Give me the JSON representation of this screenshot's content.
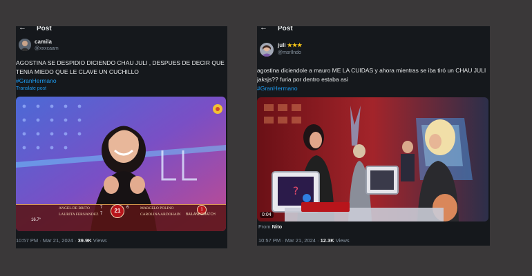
{
  "post1": {
    "header": {
      "title": "Post",
      "back_icon": "arrow-left-icon"
    },
    "author": {
      "name": "camila",
      "handle": "@xxxcaam"
    },
    "text": "AGOSTINA SE DESPIDIO DICIENDO CHAU JULI , DESPUES DE DECIR QUE TENIA MIEDO QUE LE CLAVE UN CUCHILLO",
    "hashtag": "#GranHermano",
    "translate": "Translate post",
    "media": {
      "scoreboard": {
        "left_names": [
          "ANGEL DE BRITO",
          "LAURITA FERNANDEZ"
        ],
        "left_scores": [
          "7",
          "7"
        ],
        "center_score": "21",
        "right_names": [
          "MARCELO POLINO",
          "CAROLINA ARDOHAIN"
        ],
        "right_scores": [
          "6",
          ""
        ],
        "right_far": [
          "",
          "BAILANDOMATCH"
        ],
        "right_badge": "1",
        "corner_temp": "16.7°"
      }
    },
    "meta": {
      "time": "10:57 PM · Mar 21, 2024 ·",
      "views_count": "39.9K",
      "views_label": "Views"
    }
  },
  "post2": {
    "header": {
      "title": "Post",
      "back_icon": "arrow-left-icon"
    },
    "author": {
      "name": "juli",
      "stars": "★★★",
      "handle": "@msrIlndo"
    },
    "text": "agostina diciendole a mauro ME LA CUIDAS y ahora mientras se iba tiró un CHAU JULI jaksjs?? furia por dentro estaba asi",
    "hashtag": "#GranHermano",
    "media": {
      "timestamp": "0:04"
    },
    "from": {
      "label": "From",
      "source": "Nito"
    },
    "meta": {
      "time": "10:57 PM · Mar 21, 2024 ·",
      "views_count": "12.3K",
      "views_label": "Views"
    }
  },
  "colors": {
    "background": "#3a3839",
    "card": "#15181c",
    "accent_link": "#1d9bf0",
    "muted": "#8b98a5"
  }
}
